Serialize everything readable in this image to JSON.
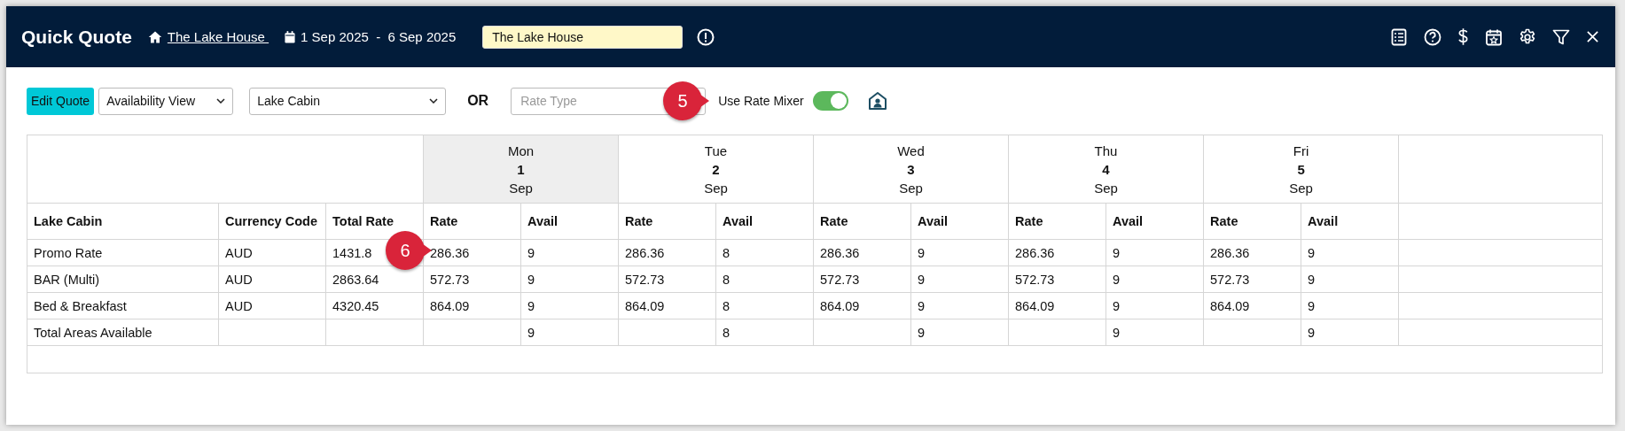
{
  "header": {
    "title": "Quick Quote",
    "property_link": "The Lake House ",
    "dates": "1 Sep 2025  -  6 Sep 2025",
    "search": {
      "value": "The Lake House"
    }
  },
  "toolbar": {
    "edit_button": "Edit Quote",
    "view_select": "Availability View",
    "room_select": "Lake Cabin",
    "or_label": "OR",
    "rate_type": {
      "placeholder": "Rate Type"
    },
    "rate_mixer": {
      "label": "Use Rate Mixer",
      "on": true
    }
  },
  "callouts": [
    {
      "number": "5"
    },
    {
      "number": "6"
    }
  ],
  "table": {
    "columns": [
      "Lake Cabin",
      "Currency Code",
      "Total Rate"
    ],
    "days": [
      {
        "weekday": "Mon",
        "day": "1",
        "month": "Sep",
        "selected": true,
        "columns": [
          "Rate",
          "Avail"
        ]
      },
      {
        "weekday": "Tue",
        "day": "2",
        "month": "Sep",
        "selected": false,
        "columns": [
          "Rate",
          "Avail"
        ]
      },
      {
        "weekday": "Wed",
        "day": "3",
        "month": "Sep",
        "selected": false,
        "columns": [
          "Rate",
          "Avail"
        ]
      },
      {
        "weekday": "Thu",
        "day": "4",
        "month": "Sep",
        "selected": false,
        "columns": [
          "Rate",
          "Avail"
        ]
      },
      {
        "weekday": "Fri",
        "day": "5",
        "month": "Sep",
        "selected": false,
        "columns": [
          "Rate",
          "Avail"
        ]
      }
    ],
    "rows": [
      {
        "name": "Promo Rate",
        "currency": "AUD",
        "total": "1431.8",
        "cells": [
          {
            "rate": "286.36",
            "avail": "9"
          },
          {
            "rate": "286.36",
            "avail": "8"
          },
          {
            "rate": "286.36",
            "avail": "9"
          },
          {
            "rate": "286.36",
            "avail": "9"
          },
          {
            "rate": "286.36",
            "avail": "9"
          }
        ]
      },
      {
        "name": "BAR (Multi)",
        "currency": "AUD",
        "total": "2863.64",
        "cells": [
          {
            "rate": "572.73",
            "avail": "9"
          },
          {
            "rate": "572.73",
            "avail": "8"
          },
          {
            "rate": "572.73",
            "avail": "9"
          },
          {
            "rate": "572.73",
            "avail": "9"
          },
          {
            "rate": "572.73",
            "avail": "9"
          }
        ]
      },
      {
        "name": "Bed & Breakfast",
        "currency": "AUD",
        "total": "4320.45",
        "cells": [
          {
            "rate": "864.09",
            "avail": "9"
          },
          {
            "rate": "864.09",
            "avail": "8"
          },
          {
            "rate": "864.09",
            "avail": "9"
          },
          {
            "rate": "864.09",
            "avail": "9"
          },
          {
            "rate": "864.09",
            "avail": "9"
          }
        ]
      },
      {
        "name": "Total Areas Available",
        "cells": [
          {
            "avail": "9"
          },
          {
            "avail": "8"
          },
          {
            "avail": "9"
          },
          {
            "avail": "9"
          },
          {
            "avail": "9"
          }
        ]
      }
    ]
  }
}
